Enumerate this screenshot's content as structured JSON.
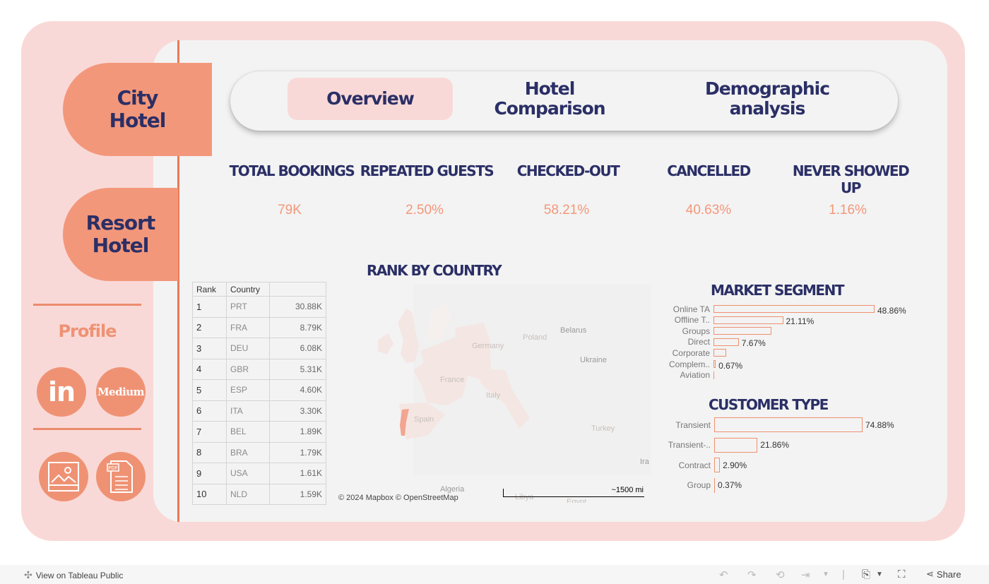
{
  "hotels": {
    "city": "City\nHotel",
    "resort": "Resort\nHotel"
  },
  "sidebar": {
    "profile_label": "Profile",
    "links": [
      {
        "name": "linkedin",
        "text": "in"
      },
      {
        "name": "medium",
        "text": "Medium"
      },
      {
        "name": "image-gallery",
        "text": ""
      },
      {
        "name": "pdf-document",
        "text": "PDF"
      }
    ]
  },
  "nav": {
    "tabs": [
      {
        "label": "Overview",
        "active": true
      },
      {
        "label": "Hotel\nComparison",
        "active": false
      },
      {
        "label": "Demographic\nanalysis",
        "active": false
      }
    ]
  },
  "kpis": [
    {
      "label": "TOTAL BOOKINGS",
      "value": "79K"
    },
    {
      "label": "REPEATED GUESTS",
      "value": "2.50%"
    },
    {
      "label": "CHECKED-OUT",
      "value": "58.21%"
    },
    {
      "label": "CANCELLED",
      "value": "40.63%"
    },
    {
      "label": "NEVER SHOWED UP",
      "value": "1.16%"
    }
  ],
  "rank_table": {
    "title": "RANK BY COUNTRY",
    "headers": [
      "Rank",
      "Country",
      ""
    ],
    "rows": [
      {
        "rank": "1",
        "country": "PRT",
        "value": "30.88K"
      },
      {
        "rank": "2",
        "country": "FRA",
        "value": "8.79K"
      },
      {
        "rank": "3",
        "country": "DEU",
        "value": "6.08K"
      },
      {
        "rank": "4",
        "country": "GBR",
        "value": "5.31K"
      },
      {
        "rank": "5",
        "country": "ESP",
        "value": "4.60K"
      },
      {
        "rank": "6",
        "country": "ITA",
        "value": "3.30K"
      },
      {
        "rank": "7",
        "country": "BEL",
        "value": "1.89K"
      },
      {
        "rank": "8",
        "country": "BRA",
        "value": "1.79K"
      },
      {
        "rank": "9",
        "country": "USA",
        "value": "1.61K"
      },
      {
        "rank": "10",
        "country": "NLD",
        "value": "1.59K"
      }
    ]
  },
  "map": {
    "labels": {
      "germany": "Germany",
      "poland": "Poland",
      "belarus": "Belarus",
      "ukraine": "Ukraine",
      "france": "France",
      "italy": "Italy",
      "spain": "Spain",
      "turkey": "Turkey",
      "iraq": "Ira",
      "algeria": "Algeria",
      "libya": "Libya",
      "egypt": "Egypt"
    },
    "attribution": "© 2024 Mapbox  © OpenStreetMap",
    "scale": "~1500 mi",
    "highlight_color": "#f2a590"
  },
  "chart_data": [
    {
      "type": "bar",
      "title": "MARKET SEGMENT",
      "orientation": "horizontal",
      "categories": [
        "Online TA",
        "Offline T..",
        "Groups",
        "Direct",
        "Corporate",
        "Complem..",
        "Aviation"
      ],
      "values": [
        48.86,
        21.11,
        17.5,
        7.67,
        3.8,
        0.67,
        0.3
      ],
      "value_labels": [
        "48.86%",
        "21.11%",
        "",
        "7.67%",
        "",
        "0.67%",
        ""
      ],
      "unit": "%"
    },
    {
      "type": "bar",
      "title": "CUSTOMER TYPE",
      "orientation": "horizontal",
      "categories": [
        "Transient",
        "Transient-..",
        "Contract",
        "Group"
      ],
      "values": [
        74.88,
        21.86,
        2.9,
        0.37
      ],
      "value_labels": [
        "74.88%",
        "21.86%",
        "2.90%",
        "0.37%"
      ],
      "unit": "%"
    }
  ],
  "footer": {
    "view_on": "View on Tableau Public",
    "share": "Share"
  },
  "colors": {
    "accent": "#f3977a",
    "navy": "#2b2f66",
    "pink_bg": "#f9d9d7",
    "panel_bg": "#f3f3f3",
    "bar_stroke": "#f0906f"
  }
}
